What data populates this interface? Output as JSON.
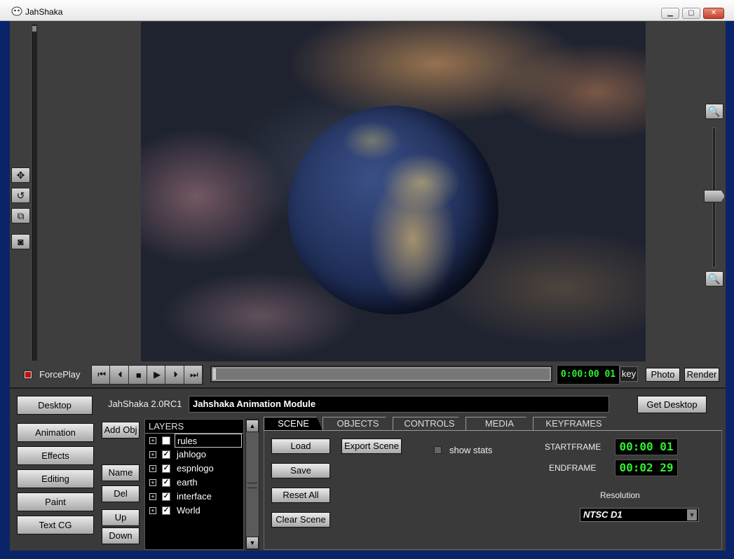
{
  "window": {
    "title": "JahShaka",
    "min": "▁",
    "max": "▢",
    "close": "✕"
  },
  "viewport_tools": [
    {
      "icon": "move-icon",
      "glyph": "✥"
    },
    {
      "icon": "rotate-icon",
      "glyph": "↺"
    },
    {
      "icon": "scale-icon",
      "glyph": "⧉"
    },
    {
      "icon": "camera-icon",
      "glyph": "◙"
    }
  ],
  "zoom": {
    "in_glyph": "🔍",
    "out_glyph": "🔍",
    "in_icon": "zoom-in-icon",
    "out_icon": "zoom-out-icon"
  },
  "transport": {
    "forceplay_label": "ForcePlay",
    "forceplay_checked": true,
    "buttons": [
      "⏮",
      "⏴",
      "■",
      "▶",
      "⏵",
      "⏭"
    ],
    "timecode": "0:00:00 01",
    "key_label": "key",
    "photo_label": "Photo",
    "render_label": "Render"
  },
  "left_nav": {
    "desktop": "Desktop",
    "items": [
      "Animation",
      "Effects",
      "Editing",
      "Paint",
      "Text CG"
    ]
  },
  "header": {
    "version": "JahShaka 2.0RC1",
    "module": "Jahshaka Animation Module",
    "get_desktop": "Get Desktop"
  },
  "layer_buttons": {
    "add": "Add Obj",
    "name": "Name",
    "del": "Del",
    "up": "Up",
    "down": "Down"
  },
  "layers": {
    "header": "LAYERS",
    "items": [
      {
        "name": "rules",
        "checked": false,
        "mark": ""
      },
      {
        "name": "jahlogo",
        "checked": true,
        "mark": "✓"
      },
      {
        "name": "espnlogo",
        "checked": true,
        "mark": "✓"
      },
      {
        "name": "earth",
        "checked": true,
        "mark": "✓"
      },
      {
        "name": "interface",
        "checked": true,
        "mark": "✓"
      },
      {
        "name": "World",
        "checked": true,
        "mark": "✓"
      }
    ],
    "expander": "+"
  },
  "tabs": [
    "SCENE",
    "OBJECTS",
    "CONTROLS",
    "MEDIA",
    "KEYFRAMES"
  ],
  "scene": {
    "load": "Load",
    "save": "Save",
    "reset_all": "Reset All",
    "clear_scene": "Clear Scene",
    "export_scene": "Export Scene",
    "show_stats": "show stats",
    "startframe_label": "STARTFRAME",
    "startframe": "00:00 01",
    "endframe_label": "ENDFRAME",
    "endframe": "00:02 29",
    "resolution_label": "Resolution",
    "resolution": "NTSC D1",
    "dropdown_glyph": "▼"
  },
  "colors": {
    "lcd_green": "#2ef02e",
    "forceplay_red": "#c01010"
  }
}
